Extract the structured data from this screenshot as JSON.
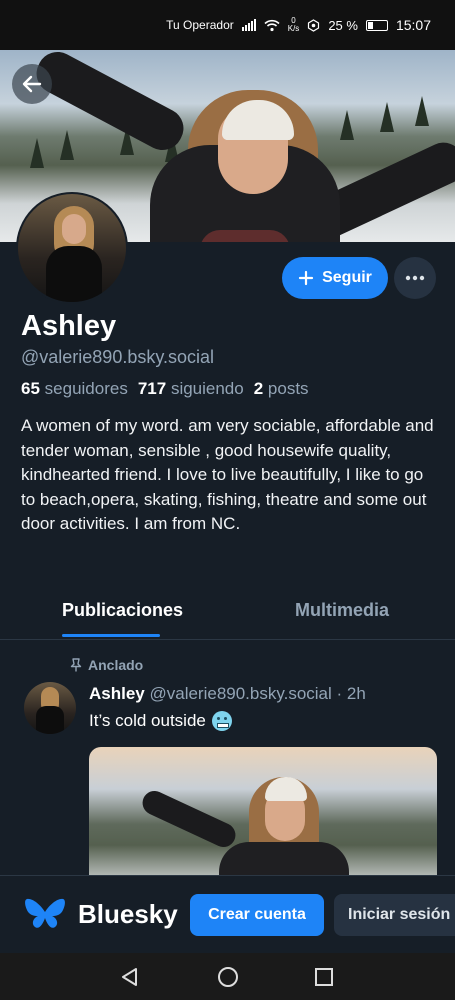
{
  "status_bar": {
    "carrier": "Tu Operador",
    "net_speed_value": "0",
    "net_speed_unit": "K/s",
    "battery": "25 %",
    "time": "15:07"
  },
  "profile": {
    "name": "Ashley",
    "handle": "@valerie890.bsky.social",
    "followers_count": "65",
    "followers_label": "seguidores",
    "following_count": "717",
    "following_label": "siguiendo",
    "posts_count": "2",
    "posts_label": "posts",
    "bio": "A women of my word. am very sociable, affordable and tender woman, sensible , good housewife quality, kindhearted friend. I love to live beautifully, I like to go to beach,opera, skating, fishing, theatre and some out door activities. I am from NC.",
    "follow_label": "Seguir"
  },
  "tabs": [
    {
      "label": "Publicaciones",
      "active": true
    },
    {
      "label": "Multimedia",
      "active": false
    }
  ],
  "post": {
    "pinned_label": "Anclado",
    "author_name": "Ashley",
    "author_handle": "@valerie890.bsky.social",
    "time": "· 2h",
    "text": "It’s cold outside"
  },
  "bottom_bar": {
    "brand": "Bluesky",
    "create_account": "Crear cuenta",
    "login": "Iniciar sesión"
  },
  "colors": {
    "background": "#161e27",
    "accent": "#1e84f7",
    "muted_text": "#93a4b5"
  }
}
